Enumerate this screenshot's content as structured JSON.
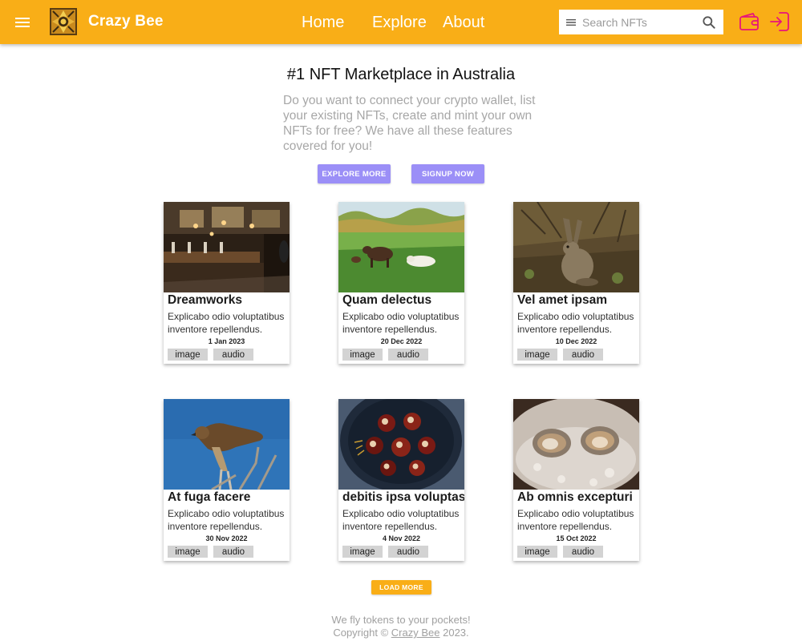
{
  "header": {
    "brand": "Crazy Bee",
    "nav": {
      "home": "Home",
      "explore": "Explore",
      "about": "About"
    },
    "search": {
      "placeholder": "Search NFTs",
      "value": ""
    },
    "accent_color": "#f9ae17",
    "icons": [
      "menu-icon",
      "bee-logo",
      "search-icon",
      "wallet-icon",
      "login-icon"
    ]
  },
  "hero": {
    "title": "#1 NFT Marketplace in Australia",
    "text": "Do you want to connect your crypto wallet, list your existing NFTs, create and mint your own NFTs for free? We have all these features covered for you!",
    "explore_label": "EXPLORE MORE",
    "signup_label": "SIGNUP NOW",
    "button_color": "#9b8ff7"
  },
  "cards": [
    {
      "title": "Dreamworks",
      "description": "Explicabo odio voluptatibus inventore repellendus.",
      "date": "1 Jan 2023",
      "tags": [
        "image",
        "audio"
      ]
    },
    {
      "title": "Quam delectus",
      "description": "Explicabo odio voluptatibus inventore repellendus.",
      "date": "20 Dec 2022",
      "tags": [
        "image",
        "audio"
      ]
    },
    {
      "title": "Vel amet ipsam",
      "description": "Explicabo odio voluptatibus inventore repellendus.",
      "date": "10 Dec 2022",
      "tags": [
        "image",
        "audio"
      ]
    },
    {
      "title": "At fuga facere",
      "description": "Explicabo odio voluptatibus inventore repellendus.",
      "date": "30 Nov 2022",
      "tags": [
        "image",
        "audio"
      ]
    },
    {
      "title": "debitis ipsa voluptas",
      "description": "Explicabo odio voluptatibus inventore repellendus.",
      "date": "4 Nov 2022",
      "tags": [
        "image",
        "audio"
      ]
    },
    {
      "title": "Ab omnis excepturi",
      "description": "Explicabo odio voluptatibus inventore repellendus.",
      "date": "15 Oct 2022",
      "tags": [
        "image",
        "audio"
      ]
    }
  ],
  "load_more_label": "LOAD MORE",
  "footer": {
    "line1": "We fly tokens to your pockets!",
    "copyright_prefix": "Copyright ©",
    "link": "Crazy Bee",
    "year": "2023."
  }
}
